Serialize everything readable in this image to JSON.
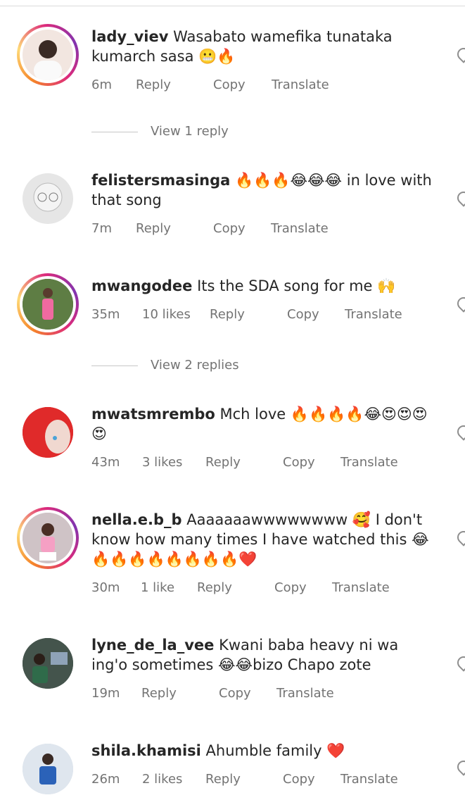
{
  "comments": [
    {
      "username": "lady_viev",
      "text": "Wasabato wamefika tunataka kumarch sasa 😬🔥",
      "time": "6m",
      "likes": "",
      "reply": "Reply",
      "copy": "Copy",
      "translate": "Translate",
      "view_replies": "View 1 reply",
      "story": true,
      "avatar_color": "#f2e6e0"
    },
    {
      "username": "felistersmasinga",
      "text": "🔥🔥🔥😂😂😂 in love with that song",
      "time": "7m",
      "likes": "",
      "reply": "Reply",
      "copy": "Copy",
      "translate": "Translate",
      "view_replies": "",
      "story": false,
      "avatar_color": "#e6e6e6"
    },
    {
      "username": "mwangodee",
      "text": "Its the SDA song for me 🙌",
      "time": "35m",
      "likes": "10 likes",
      "reply": "Reply",
      "copy": "Copy",
      "translate": "Translate",
      "view_replies": "View 2 replies",
      "story": true,
      "avatar_color": "#4f6b3a"
    },
    {
      "username": "mwatsmrembo",
      "text": "Mch love 🔥🔥🔥🔥😂😍😍😍😍",
      "time": "43m",
      "likes": "3 likes",
      "reply": "Reply",
      "copy": "Copy",
      "translate": "Translate",
      "view_replies": "",
      "story": false,
      "avatar_color": "#d81f2a"
    },
    {
      "username": "nella.e.b_b",
      "text": "Aaaaaaawwwwwwww 🥰 I don't know how many times I have watched this 😂🔥🔥🔥🔥🔥🔥🔥🔥❤️",
      "time": "30m",
      "likes": "1 like",
      "reply": "Reply",
      "copy": "Copy",
      "translate": "Translate",
      "view_replies": "",
      "story": true,
      "avatar_color": "#d9c4c8"
    },
    {
      "username": "lyne_de_la_vee",
      "text": "Kwani baba heavy ni wa ing'o sometimes 😂😂bizo Chapo zote",
      "time": "19m",
      "likes": "",
      "reply": "Reply",
      "copy": "Copy",
      "translate": "Translate",
      "view_replies": "",
      "story": false,
      "avatar_color": "#3d4a44"
    },
    {
      "username": "shila.khamisi",
      "text": "Ahumble family ❤️",
      "time": "26m",
      "likes": "2 likes",
      "reply": "Reply",
      "copy": "Copy",
      "translate": "Translate",
      "view_replies": "",
      "story": false,
      "avatar_color": "#c9d3df"
    }
  ]
}
